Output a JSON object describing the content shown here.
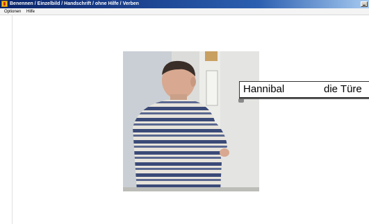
{
  "window": {
    "title": "Benennen / Einzelbild / Handschrift / ohne Hilfe / Verben"
  },
  "menu": {
    "items": [
      "Optionen",
      "Hilfe"
    ]
  },
  "answer": {
    "name": "Hannibal",
    "noun": "die Türe"
  }
}
